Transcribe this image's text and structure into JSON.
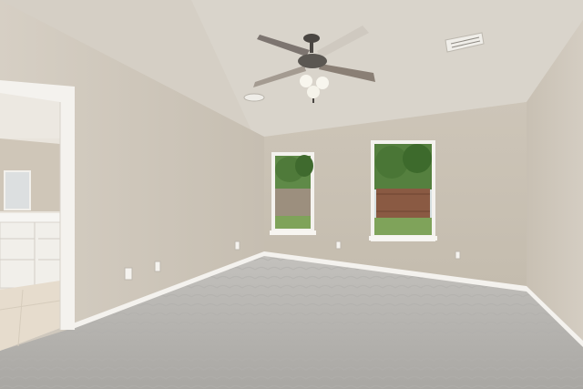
{
  "scene": {
    "subject": "empty-bedroom-interior",
    "elements": [
      "vaulted-ceiling",
      "ceiling-fan",
      "hvac-vent",
      "left-window",
      "right-window",
      "bathroom-doorway",
      "bathroom-vanity",
      "carpet-floor",
      "baseboards",
      "electrical-outlets"
    ]
  },
  "colors": {
    "ceiling": "#d9d4cb",
    "wall_back": "#cbc3b6",
    "wall_left": "#d2cbc0",
    "wall_right": "#cfc8bd",
    "trim": "#f4f2ee",
    "carpet": "#b9b7b3",
    "foliage": "#4f7a3a",
    "fence": "#8a5a43",
    "lawn": "#7fa35a"
  }
}
